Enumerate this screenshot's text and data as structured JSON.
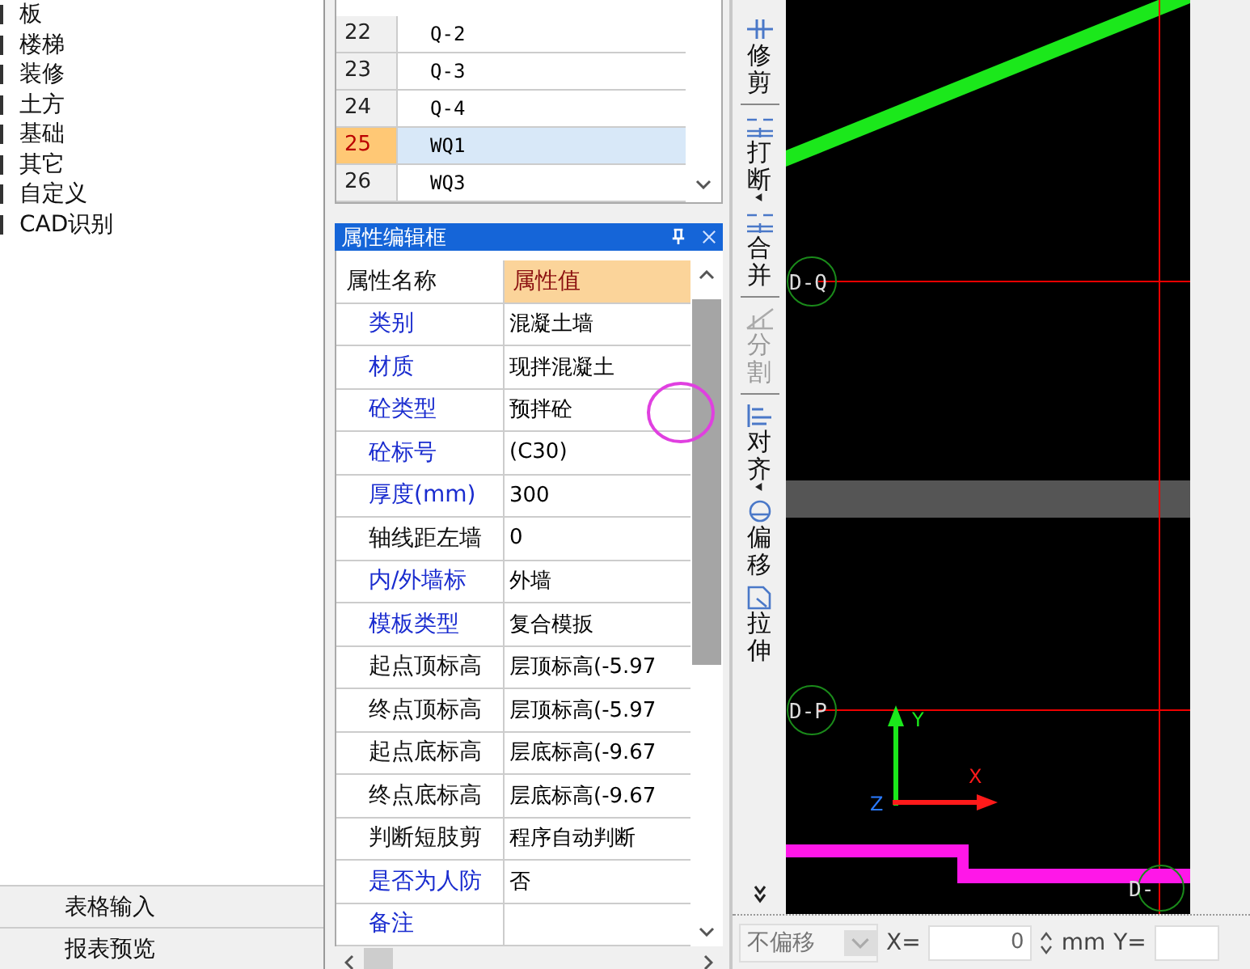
{
  "tree": {
    "items": [
      {
        "label": "板"
      },
      {
        "label": "楼梯"
      },
      {
        "label": "装修"
      },
      {
        "label": "土方"
      },
      {
        "label": "基础"
      },
      {
        "label": "其它"
      },
      {
        "label": "自定义"
      },
      {
        "label": "CAD识别"
      }
    ]
  },
  "side_buttons": [
    "表格输入",
    "报表预览"
  ],
  "component_list": {
    "rows": [
      {
        "number": "22",
        "name": "Q-2",
        "selected": false
      },
      {
        "number": "23",
        "name": "Q-3",
        "selected": false
      },
      {
        "number": "24",
        "name": "Q-4",
        "selected": false
      },
      {
        "number": "25",
        "name": "WQ1",
        "selected": true
      },
      {
        "number": "26",
        "name": "WQ3",
        "selected": false
      }
    ]
  },
  "property_panel": {
    "title": "属性编辑框",
    "columns": [
      "属性名称",
      "属性值"
    ],
    "rows": [
      {
        "name": "类别",
        "value": "混凝土墙",
        "public": true
      },
      {
        "name": "材质",
        "value": "现拌混凝土",
        "public": true
      },
      {
        "name": "砼类型",
        "value": "预拌砼",
        "public": true
      },
      {
        "name": "砼标号",
        "value": "(C30)",
        "public": true
      },
      {
        "name": "厚度(mm)",
        "value": "300",
        "public": true
      },
      {
        "name": "轴线距左墙",
        "value": "0",
        "public": false
      },
      {
        "name": "内/外墙标",
        "value": "外墙",
        "public": true
      },
      {
        "name": "模板类型",
        "value": "复合模扳",
        "public": true
      },
      {
        "name": "起点顶标高",
        "value": "层顶标高(-5.97",
        "public": false
      },
      {
        "name": "终点顶标高",
        "value": "层顶标高(-5.97",
        "public": false
      },
      {
        "name": "起点底标高",
        "value": "层底标高(-9.67",
        "public": false
      },
      {
        "name": "终点底标高",
        "value": "层底标高(-9.67",
        "public": false
      },
      {
        "name": "判断短肢剪",
        "value": "程序自动判断",
        "public": false
      },
      {
        "name": "是否为人防",
        "value": "否",
        "public": true
      },
      {
        "name": "备注",
        "value": "",
        "public": true
      }
    ]
  },
  "toolbar": [
    {
      "label": "修剪",
      "kind": "trim",
      "disabled": false,
      "dropdown": false
    },
    {
      "label": "打断",
      "kind": "break",
      "disabled": false,
      "dropdown": true
    },
    {
      "label": "合并",
      "kind": "merge",
      "disabled": false,
      "dropdown": false
    },
    {
      "label": "分割",
      "kind": "split",
      "disabled": true,
      "dropdown": false
    },
    {
      "label": "对齐",
      "kind": "align",
      "disabled": false,
      "dropdown": true
    },
    {
      "label": "偏移",
      "kind": "offset",
      "disabled": false,
      "dropdown": false
    },
    {
      "label": "拉伸",
      "kind": "stretch",
      "disabled": false,
      "dropdown": false
    }
  ],
  "canvas": {
    "axis_labels": [
      "D-Q",
      "D-P",
      "D-"
    ],
    "ucs": [
      "Y",
      "X",
      "Z"
    ]
  },
  "status_bar": {
    "offset_mode": "不偏移",
    "x_label": "X=",
    "x_value": "0",
    "unit": "mm",
    "y_label": "Y="
  }
}
